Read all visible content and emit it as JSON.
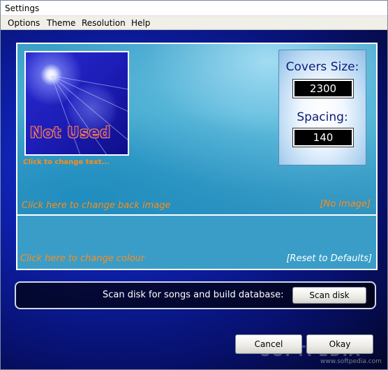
{
  "window": {
    "title": "Settings"
  },
  "menu": {
    "items": [
      "Options",
      "Theme",
      "Resolution",
      "Help"
    ]
  },
  "preview": {
    "cover_text": "Not Used",
    "change_text_link": "Click to change text...",
    "change_back_link": "Click here to change back image",
    "no_image_link": "[No image]",
    "change_colour_link": "Click here to change colour",
    "reset_link": "[Reset to Defaults]"
  },
  "settings": {
    "covers_size_label": "Covers Size:",
    "covers_size_value": "2300",
    "spacing_label": "Spacing:",
    "spacing_value": "140"
  },
  "scan": {
    "label": "Scan disk for songs and build database:",
    "button": "Scan disk"
  },
  "buttons": {
    "cancel": "Cancel",
    "okay": "Okay"
  },
  "watermark": {
    "text": "SOFTPEDIA",
    "url": "www.softpedia.com"
  },
  "colors": {
    "accent_orange": "#ff8c1a",
    "background_blue": "#0d1fa8",
    "panel_cyan": "#3a9dc8"
  }
}
